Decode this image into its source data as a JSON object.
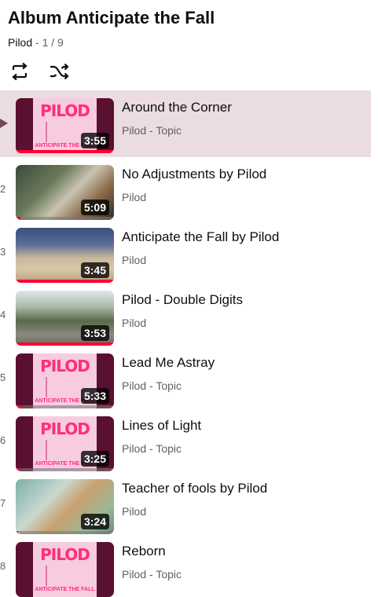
{
  "header": {
    "title": "Album Anticipate the Fall",
    "owner": "Pilod",
    "position": "- 1 / 9"
  },
  "controls": {
    "loop": "loop-icon",
    "shuffle": "shuffle-icon"
  },
  "tracks": [
    {
      "index": "",
      "title": "Around the Corner",
      "channel": "Pilod - Topic",
      "duration": "3:55",
      "thumb": "album-art",
      "progress": 1.0,
      "active": true
    },
    {
      "index": "2",
      "title": "No Adjustments by Pilod",
      "channel": "Pilod",
      "duration": "5:09",
      "thumb": "video-people",
      "progress": 0.05
    },
    {
      "index": "3",
      "title": "Anticipate the Fall by Pilod",
      "channel": "Pilod",
      "duration": "3:45",
      "thumb": "video-hall",
      "progress": 1.0
    },
    {
      "index": "4",
      "title": "Pilod - Double Digits",
      "channel": "Pilod",
      "duration": "3:53",
      "thumb": "video-road",
      "progress": 1.0
    },
    {
      "index": "5",
      "title": "Lead Me Astray",
      "channel": "Pilod - Topic",
      "duration": "5:33",
      "thumb": "album-art",
      "progress": 0.06
    },
    {
      "index": "6",
      "title": "Lines of Light",
      "channel": "Pilod - Topic",
      "duration": "3:25",
      "thumb": "album-art",
      "progress": 0.04
    },
    {
      "index": "7",
      "title": "Teacher of fools by Pilod",
      "channel": "Pilod",
      "duration": "3:24",
      "thumb": "video-dog",
      "progress": 0.02
    },
    {
      "index": "8",
      "title": "Reborn",
      "channel": "Pilod - Topic",
      "duration": "",
      "thumb": "album-art",
      "progress": 0
    }
  ],
  "album_art_text": {
    "word": "PILOD",
    "subtitle": "ANTICIPATE THE FALL"
  },
  "colors": {
    "accent": "#ff0033",
    "active_row": "#ebdcdf",
    "art_bg": "#5a1030",
    "art_pink": "#ff2e7a"
  }
}
